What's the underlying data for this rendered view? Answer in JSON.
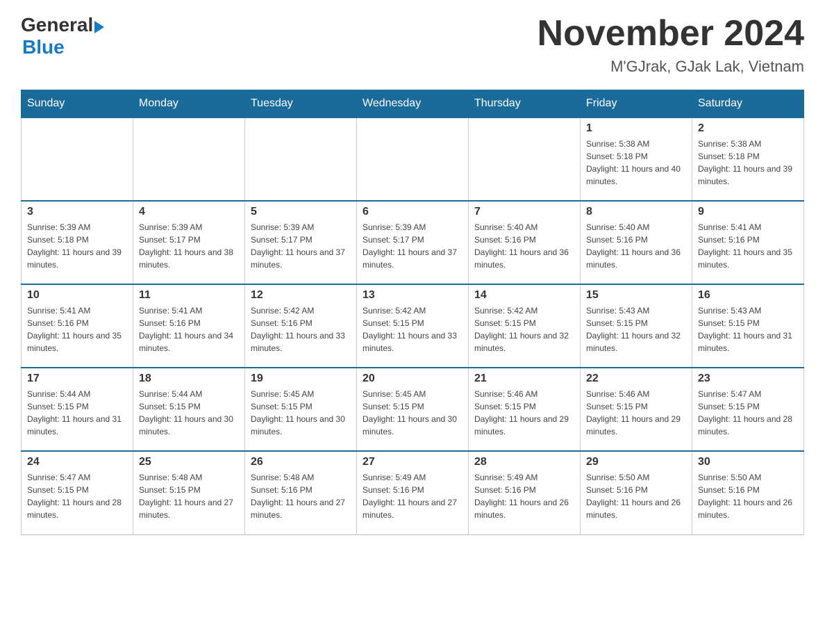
{
  "header": {
    "logo_general": "General",
    "logo_blue": "Blue",
    "title": "November 2024",
    "subtitle": "M'GJrak, GJak Lak, Vietnam"
  },
  "days_of_week": [
    "Sunday",
    "Monday",
    "Tuesday",
    "Wednesday",
    "Thursday",
    "Friday",
    "Saturday"
  ],
  "weeks": [
    [
      {
        "day": "",
        "info": ""
      },
      {
        "day": "",
        "info": ""
      },
      {
        "day": "",
        "info": ""
      },
      {
        "day": "",
        "info": ""
      },
      {
        "day": "",
        "info": ""
      },
      {
        "day": "1",
        "info": "Sunrise: 5:38 AM\nSunset: 5:18 PM\nDaylight: 11 hours and 40 minutes."
      },
      {
        "day": "2",
        "info": "Sunrise: 5:38 AM\nSunset: 5:18 PM\nDaylight: 11 hours and 39 minutes."
      }
    ],
    [
      {
        "day": "3",
        "info": "Sunrise: 5:39 AM\nSunset: 5:18 PM\nDaylight: 11 hours and 39 minutes."
      },
      {
        "day": "4",
        "info": "Sunrise: 5:39 AM\nSunset: 5:17 PM\nDaylight: 11 hours and 38 minutes."
      },
      {
        "day": "5",
        "info": "Sunrise: 5:39 AM\nSunset: 5:17 PM\nDaylight: 11 hours and 37 minutes."
      },
      {
        "day": "6",
        "info": "Sunrise: 5:39 AM\nSunset: 5:17 PM\nDaylight: 11 hours and 37 minutes."
      },
      {
        "day": "7",
        "info": "Sunrise: 5:40 AM\nSunset: 5:16 PM\nDaylight: 11 hours and 36 minutes."
      },
      {
        "day": "8",
        "info": "Sunrise: 5:40 AM\nSunset: 5:16 PM\nDaylight: 11 hours and 36 minutes."
      },
      {
        "day": "9",
        "info": "Sunrise: 5:41 AM\nSunset: 5:16 PM\nDaylight: 11 hours and 35 minutes."
      }
    ],
    [
      {
        "day": "10",
        "info": "Sunrise: 5:41 AM\nSunset: 5:16 PM\nDaylight: 11 hours and 35 minutes."
      },
      {
        "day": "11",
        "info": "Sunrise: 5:41 AM\nSunset: 5:16 PM\nDaylight: 11 hours and 34 minutes."
      },
      {
        "day": "12",
        "info": "Sunrise: 5:42 AM\nSunset: 5:16 PM\nDaylight: 11 hours and 33 minutes."
      },
      {
        "day": "13",
        "info": "Sunrise: 5:42 AM\nSunset: 5:15 PM\nDaylight: 11 hours and 33 minutes."
      },
      {
        "day": "14",
        "info": "Sunrise: 5:42 AM\nSunset: 5:15 PM\nDaylight: 11 hours and 32 minutes."
      },
      {
        "day": "15",
        "info": "Sunrise: 5:43 AM\nSunset: 5:15 PM\nDaylight: 11 hours and 32 minutes."
      },
      {
        "day": "16",
        "info": "Sunrise: 5:43 AM\nSunset: 5:15 PM\nDaylight: 11 hours and 31 minutes."
      }
    ],
    [
      {
        "day": "17",
        "info": "Sunrise: 5:44 AM\nSunset: 5:15 PM\nDaylight: 11 hours and 31 minutes."
      },
      {
        "day": "18",
        "info": "Sunrise: 5:44 AM\nSunset: 5:15 PM\nDaylight: 11 hours and 30 minutes."
      },
      {
        "day": "19",
        "info": "Sunrise: 5:45 AM\nSunset: 5:15 PM\nDaylight: 11 hours and 30 minutes."
      },
      {
        "day": "20",
        "info": "Sunrise: 5:45 AM\nSunset: 5:15 PM\nDaylight: 11 hours and 30 minutes."
      },
      {
        "day": "21",
        "info": "Sunrise: 5:46 AM\nSunset: 5:15 PM\nDaylight: 11 hours and 29 minutes."
      },
      {
        "day": "22",
        "info": "Sunrise: 5:46 AM\nSunset: 5:15 PM\nDaylight: 11 hours and 29 minutes."
      },
      {
        "day": "23",
        "info": "Sunrise: 5:47 AM\nSunset: 5:15 PM\nDaylight: 11 hours and 28 minutes."
      }
    ],
    [
      {
        "day": "24",
        "info": "Sunrise: 5:47 AM\nSunset: 5:15 PM\nDaylight: 11 hours and 28 minutes."
      },
      {
        "day": "25",
        "info": "Sunrise: 5:48 AM\nSunset: 5:15 PM\nDaylight: 11 hours and 27 minutes."
      },
      {
        "day": "26",
        "info": "Sunrise: 5:48 AM\nSunset: 5:16 PM\nDaylight: 11 hours and 27 minutes."
      },
      {
        "day": "27",
        "info": "Sunrise: 5:49 AM\nSunset: 5:16 PM\nDaylight: 11 hours and 27 minutes."
      },
      {
        "day": "28",
        "info": "Sunrise: 5:49 AM\nSunset: 5:16 PM\nDaylight: 11 hours and 26 minutes."
      },
      {
        "day": "29",
        "info": "Sunrise: 5:50 AM\nSunset: 5:16 PM\nDaylight: 11 hours and 26 minutes."
      },
      {
        "day": "30",
        "info": "Sunrise: 5:50 AM\nSunset: 5:16 PM\nDaylight: 11 hours and 26 minutes."
      }
    ]
  ]
}
